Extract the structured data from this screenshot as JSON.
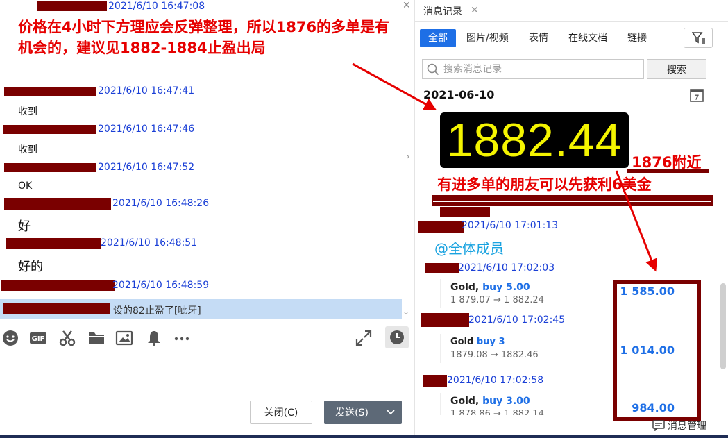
{
  "left_chat": {
    "annotation": "价格在4小时下方理应会反弹整理，所以1876的多单是有机会的，建议见1882-1884止盈出局",
    "messages": [
      {
        "time": "2021/6/10 16:47:08",
        "text": ""
      },
      {
        "time": "2021/6/10 16:47:41",
        "text": "收到"
      },
      {
        "time": "2021/6/10 16:47:46",
        "text": "收到"
      },
      {
        "time": "2021/6/10 16:47:52",
        "text": "OK"
      },
      {
        "time": "2021/6/10 16:48:26",
        "text": "好"
      },
      {
        "time": "2021/6/10 16:48:51",
        "text": "好的"
      },
      {
        "time": "2021/6/10 16:48:59",
        "text": ""
      }
    ],
    "selected_message": "设的82止盈了[呲牙]",
    "buttons": {
      "close": "关闭(C)",
      "send": "发送(S)"
    }
  },
  "history": {
    "tab_title": "消息记录",
    "filters": [
      "全部",
      "图片/视频",
      "表情",
      "在线文档",
      "链接"
    ],
    "search": {
      "placeholder": "搜索消息记录",
      "button": "搜索"
    },
    "date": "2021-06-10",
    "price_display": "1882.44",
    "annotation_near": "1876附近",
    "annotation_profit": "有进多单的朋友可以先获利6美金",
    "entries": [
      {
        "time": "2021/6/10 17:01:13"
      },
      {
        "time": "2021/6/10 17:02:03"
      },
      {
        "time": "2021/6/10 17:02:45"
      },
      {
        "time": "2021/6/10 17:02:58"
      }
    ],
    "mention": "@全体成员",
    "trades": [
      {
        "symbol": "Gold,",
        "direction": "buy 5.00",
        "prices": "1 879.07 → 1 882.24",
        "profit": "1 585.00"
      },
      {
        "symbol": "Gold",
        "direction": "buy 3",
        "prices": "1879.08 → 1882.46",
        "profit": "1 014.00"
      },
      {
        "symbol": "Gold,",
        "direction": "buy 3.00",
        "prices": "1 878.86 → 1 882.14",
        "profit": "984.00"
      }
    ],
    "manage_label": "消息管理"
  },
  "icons": [
    "emoji-icon",
    "gif-icon",
    "scissors-icon",
    "folder-icon",
    "image-icon",
    "bell-icon",
    "more-icon",
    "expand-icon",
    "clock-icon",
    "filter-icon",
    "search-icon",
    "calendar-icon",
    "message-manage-icon"
  ],
  "colors": {
    "accent_blue": "#1e6fe6",
    "timestamp_blue": "#1a3fd6",
    "annotation_red": "#e60000",
    "redaction": "#7a0000",
    "price_yellow": "#f4f400"
  }
}
